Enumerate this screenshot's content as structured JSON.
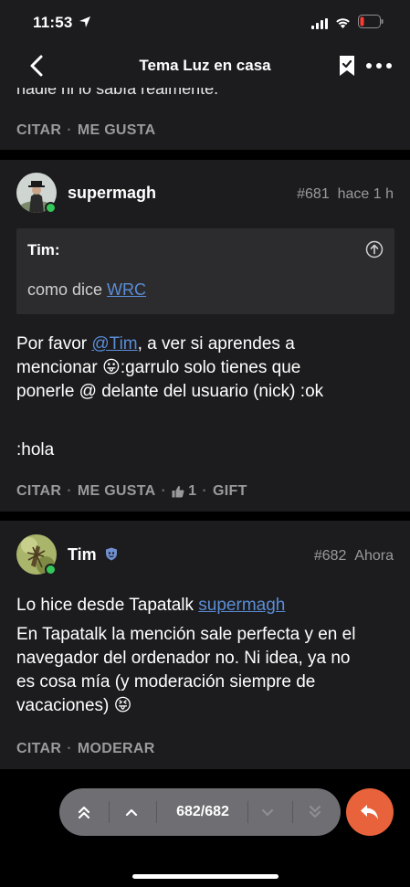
{
  "status_bar": {
    "time": "11:53"
  },
  "nav": {
    "title": "Tema Luz en casa"
  },
  "prev_post": {
    "text_fragment": "nadie ni lo sabía realmente.",
    "actions": {
      "quote": "CITAR",
      "like": "ME GUSTA"
    }
  },
  "post_681": {
    "username": "supermagh",
    "number": "#681",
    "time": "hace 1 h",
    "quote": {
      "author": "Tim:",
      "text_prefix": "como dice ",
      "text_link": "WRC"
    },
    "body": {
      "line1_prefix": "Por favor ",
      "mention": "@Tim",
      "line1_suffix": ", a ver si aprendes a",
      "line2_prefix": "mencionar ",
      "emoji1": "😛",
      "line2_suffix": ":garrulo solo tienes que",
      "line3": "ponerle @ delante del usuario (nick) :ok",
      "line4": ":hola"
    },
    "actions": {
      "quote": "CITAR",
      "like": "ME GUSTA",
      "likes_count": "1",
      "gift": "GIFT"
    }
  },
  "post_682": {
    "username": "Tim",
    "number": "#682",
    "time": "Ahora",
    "body": {
      "line1_prefix": "Lo hice desde Tapatalk ",
      "line1_link": "supermagh",
      "para2_line1": "En Tapatalk la mención sale perfecta y en el",
      "para2_line2": "navegador del ordenador no. Ni idea, ya no",
      "para2_line3": "es cosa mía (y moderación siempre de",
      "para2_line4": "vacaciones) ",
      "emoji2": "😝"
    },
    "actions": {
      "quote": "CITAR",
      "moderate": "MODERAR"
    }
  },
  "pager": {
    "count": "682/682"
  },
  "colors": {
    "background": "#000000",
    "card": "#1c1c1e",
    "link": "#5a8dd6",
    "accent": "#e8633b",
    "online": "#34c759"
  }
}
